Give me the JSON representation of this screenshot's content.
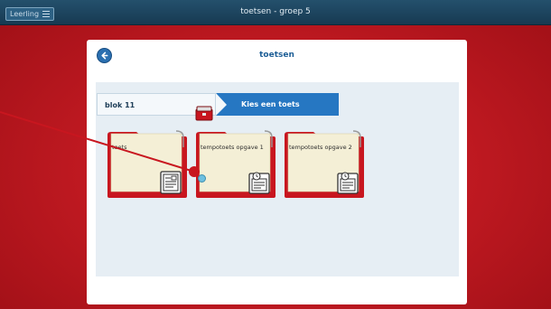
{
  "header": {
    "user_button_label": "Leerling",
    "title": "toetsen - groep 5"
  },
  "panel": {
    "title": "toetsen"
  },
  "breadcrumb": {
    "first": "blok 11",
    "second": "Kies een toets"
  },
  "cards": [
    {
      "label": "toets",
      "icon": "test-sheet-icon"
    },
    {
      "label": "tempotoets opgave 1",
      "icon": "timed-test-icon"
    },
    {
      "label": "tempotoets opgave 2",
      "icon": "timed-test-icon"
    }
  ],
  "colors": {
    "background_red": "#c21a22",
    "topbar": "#173a52",
    "accent_blue": "#2677c2",
    "folder_red": "#c8161f",
    "folder_paper": "#f4efd6"
  }
}
